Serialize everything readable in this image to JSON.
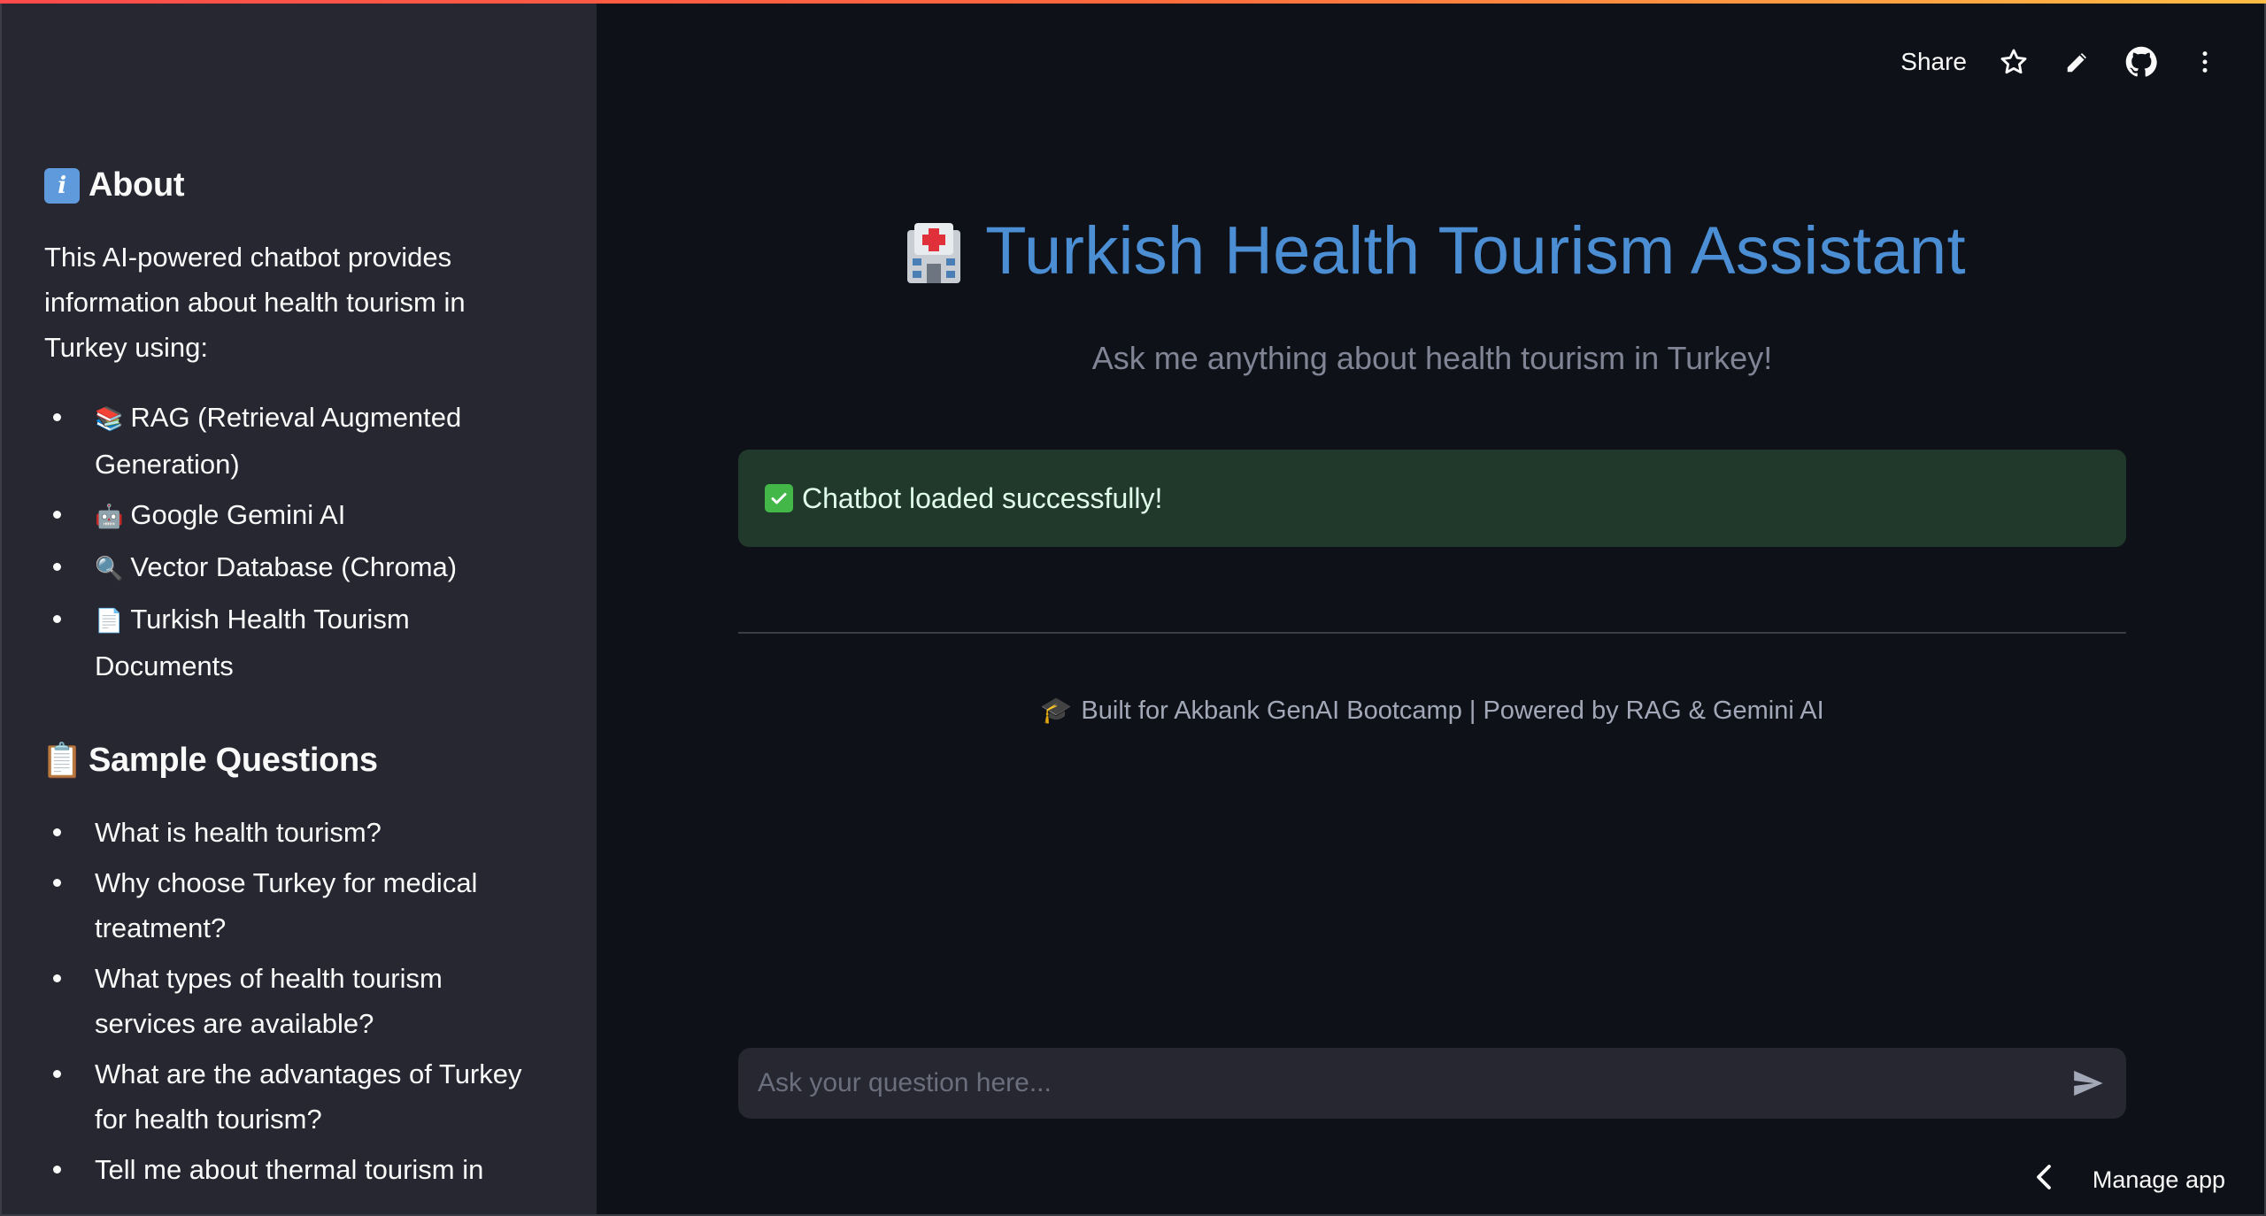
{
  "header": {
    "share_label": "Share",
    "icons": [
      "star-icon",
      "pencil-icon",
      "github-icon",
      "more-vertical-icon"
    ]
  },
  "sidebar": {
    "about": {
      "heading": "About",
      "text": "This AI-powered chatbot provides information about health tourism in Turkey using:",
      "items": [
        {
          "emoji": "📚",
          "label": "RAG (Retrieval Augmented Generation)"
        },
        {
          "emoji": "🤖",
          "label": "Google Gemini AI"
        },
        {
          "emoji": "🔍",
          "label": "Vector Database (Chroma)"
        },
        {
          "emoji": "📄",
          "label": "Turkish Health Tourism Documents"
        }
      ]
    },
    "sample": {
      "heading": "Sample Questions",
      "items": [
        "What is health tourism?",
        "Why choose Turkey for medical treatment?",
        "What types of health tourism services are available?",
        "What are the advantages of Turkey for health tourism?",
        "Tell me about thermal tourism in"
      ]
    }
  },
  "main": {
    "title": "Turkish Health Tourism Assistant",
    "subtitle": "Ask me anything about health tourism in Turkey!",
    "success_message": "Chatbot loaded successfully!",
    "footer": "Built for Akbank GenAI Bootcamp | Powered by RAG & Gemini AI",
    "chat_placeholder": "Ask your question here..."
  },
  "manage_app_label": "Manage app",
  "colors": {
    "background": "#0e1117",
    "sidebar": "#262730",
    "title": "#4b8ed4",
    "success_bg": "#21392b",
    "accent": "#ff4b4b"
  }
}
